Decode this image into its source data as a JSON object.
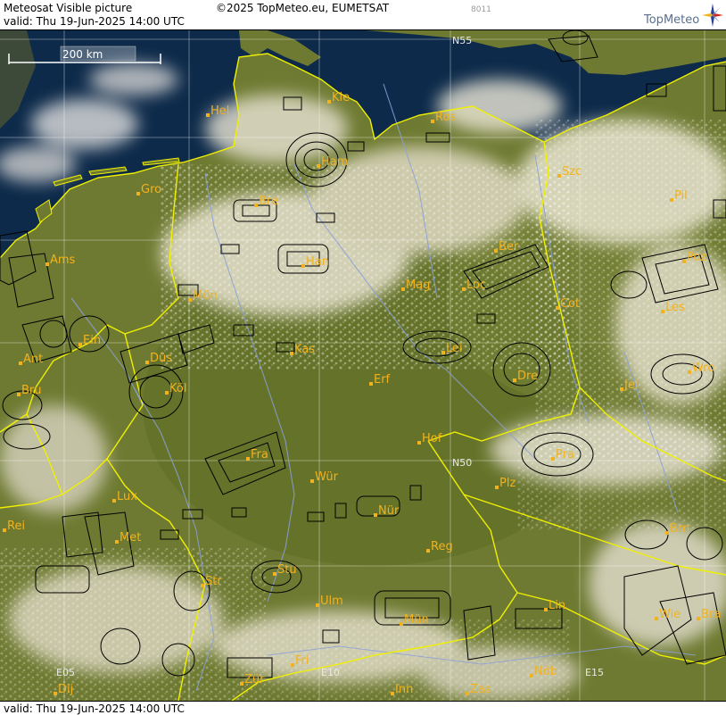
{
  "header": {
    "product_title": "Meteosat Visible picture",
    "valid_label": "valid:  Thu  19-Jun-2025  14:00 UTC",
    "copyright": "©2025 TopMeteo.eu, EUMETSAT",
    "code": "8011",
    "brand": "TopMeteo"
  },
  "footer": {
    "valid_label": "valid:  Thu  19-Jun-2025  14:00 UTC"
  },
  "map": {
    "scale_bar_label": "200 km",
    "grid_labels": [
      "N55",
      "N50",
      "E05",
      "E10",
      "E15"
    ],
    "colors": {
      "sea": "#0d2a4a",
      "land": "#6f7a2f",
      "border": "#f0f000",
      "river": "#8ca0d8",
      "airspace": "#000000",
      "city_label": "#f2b21d"
    },
    "cities": [
      {
        "name": "Hel"
      },
      {
        "name": "Kie"
      },
      {
        "name": "Ros"
      },
      {
        "name": "Ham"
      },
      {
        "name": "Gro"
      },
      {
        "name": "Bre"
      },
      {
        "name": "Szc"
      },
      {
        "name": "Pil"
      },
      {
        "name": "Ams"
      },
      {
        "name": "Han"
      },
      {
        "name": "Ber"
      },
      {
        "name": "Poz"
      },
      {
        "name": "Mün"
      },
      {
        "name": "Mag"
      },
      {
        "name": "Loc"
      },
      {
        "name": "Cot"
      },
      {
        "name": "Les"
      },
      {
        "name": "Ein"
      },
      {
        "name": "Ant"
      },
      {
        "name": "Düs"
      },
      {
        "name": "Kas"
      },
      {
        "name": "Lei"
      },
      {
        "name": "Wro"
      },
      {
        "name": "Bru"
      },
      {
        "name": "Köl"
      },
      {
        "name": "Erf"
      },
      {
        "name": "Dre"
      },
      {
        "name": "Jel"
      },
      {
        "name": "Hof"
      },
      {
        "name": "Fra"
      },
      {
        "name": "Pra"
      },
      {
        "name": "Wür"
      },
      {
        "name": "Plz"
      },
      {
        "name": "Lux"
      },
      {
        "name": "Nür"
      },
      {
        "name": "Rei"
      },
      {
        "name": "Met"
      },
      {
        "name": "Reg"
      },
      {
        "name": "Brn"
      },
      {
        "name": "Stu"
      },
      {
        "name": "Str"
      },
      {
        "name": "Ulm"
      },
      {
        "name": "Mün"
      },
      {
        "name": "Lin"
      },
      {
        "name": "Wie"
      },
      {
        "name": "Bra"
      },
      {
        "name": "Fri"
      },
      {
        "name": "Dij"
      },
      {
        "name": "Zür"
      },
      {
        "name": "Inn"
      },
      {
        "name": "Zas"
      },
      {
        "name": "Nöb"
      }
    ]
  }
}
